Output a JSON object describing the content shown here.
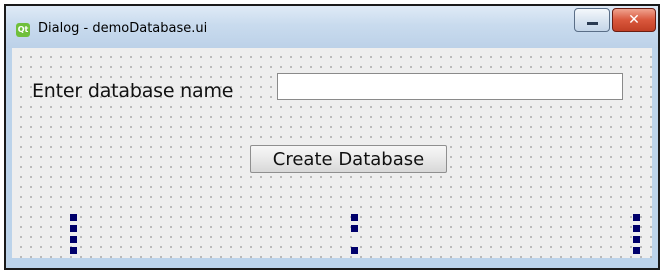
{
  "window": {
    "title": "Dialog - demoDatabase.ui",
    "app_icon_text": "Qt",
    "icons": {
      "app": "qt-designer-icon",
      "minimize": "minimize-icon",
      "close": "close-icon"
    },
    "buttons": {
      "minimize_glyph": "",
      "close_glyph": "✕"
    },
    "colors": {
      "titlebar": "#c9dbee",
      "close_button": "#d9573c",
      "canvas": "#eeeeee",
      "grid_dot": "#9a9a9a",
      "spacer_handle": "#00006b"
    }
  },
  "form": {
    "label": "Enter database name",
    "input_value": "",
    "input_placeholder": "",
    "button_label": "Create Database"
  }
}
